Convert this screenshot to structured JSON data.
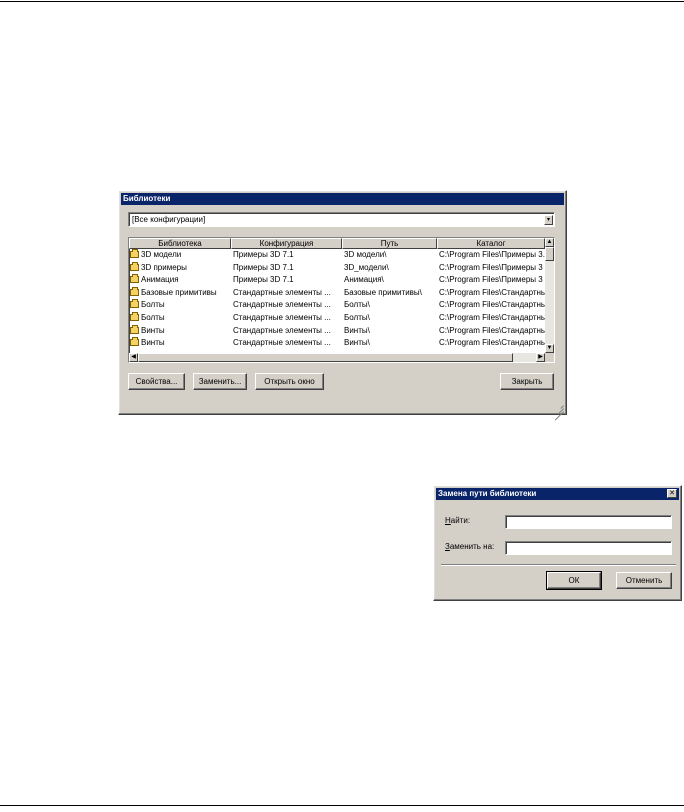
{
  "library_dialog": {
    "title": "Библиотеки",
    "config_filter": {
      "selected": "[Все конфигурации]"
    },
    "columns": [
      "Библиотека",
      "Конфигурация",
      "Путь",
      "Каталог"
    ],
    "rows": [
      {
        "name": "3D модели",
        "config": "Примеры 3D 7.1",
        "path": "3D модели\\",
        "catalog": "C:\\Program Files\\Примеры 3..."
      },
      {
        "name": "3D примеры",
        "config": "Примеры 3D 7.1",
        "path": "3D_модели\\",
        "catalog": "C:\\Program Files\\Примеры 3"
      },
      {
        "name": "Анимация",
        "config": "Примеры 3D 7.1",
        "path": "Анимация\\",
        "catalog": "C:\\Program Files\\Примеры 3"
      },
      {
        "name": "Базовые примитивы",
        "config": "Стандартные элементы ...",
        "path": "Базовые примитивы\\",
        "catalog": "C:\\Program Files\\Стандартны"
      },
      {
        "name": "Болты",
        "config": "Стандартные элементы ...",
        "path": "Болты\\",
        "catalog": "C:\\Program Files\\Стандартны"
      },
      {
        "name": "Болты",
        "config": "Стандартные элементы ...",
        "path": "Болты\\",
        "catalog": "C:\\Program Files\\Стандартны"
      },
      {
        "name": "Винты",
        "config": "Стандартные элементы ...",
        "path": "Винты\\",
        "catalog": "C:\\Program Files\\Стандартны"
      },
      {
        "name": "Винты",
        "config": "Стандартные элементы ...",
        "path": "Винты\\",
        "catalog": "C:\\Program Files\\Стандартны"
      }
    ],
    "buttons": {
      "properties": "Свойства...",
      "replace": "Заменить...",
      "open_window": "Открыть окно",
      "close": "Закрыть"
    }
  },
  "replace_dialog": {
    "title": "Замена пути библиотеки",
    "find_label": "Найти:",
    "replace_label": "Заменить на:",
    "find_value": "",
    "replace_value": "",
    "ok": "ОК",
    "cancel": "Отменить"
  },
  "colors": {
    "titlebar": "#0a246a",
    "face": "#d4d0c8",
    "folder": "#f4d264"
  }
}
